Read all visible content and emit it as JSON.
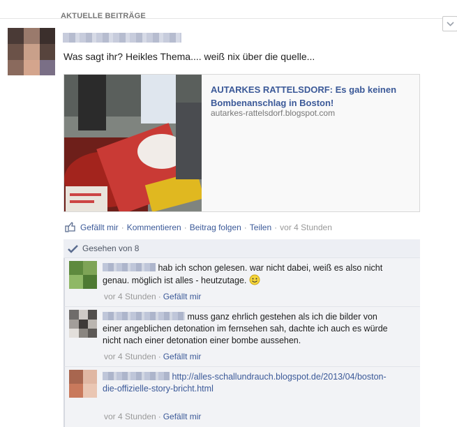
{
  "section": {
    "title": "AKTUELLE BEITRÄGE"
  },
  "post": {
    "text": "Was sagt ihr? Heikles Thema.... weiß nix über die quelle...",
    "link": {
      "title": "AUTARKES RATTELSDORF: Es gab keinen Bombenanschlag in Boston!",
      "domain": "autarkes-rattelsdorf.blogspot.com"
    },
    "actions": {
      "like": "Gefällt mir",
      "comment": "Kommentieren",
      "follow": "Beitrag folgen",
      "share": "Teilen",
      "time": "vor 4 Stunden"
    },
    "seen": "Gesehen von 8"
  },
  "comments": [
    {
      "text": "hab ich schon gelesen. war nicht dabei, weiß es also nicht genau. möglich ist alles - heutzutage.",
      "time": "vor 4 Stunden",
      "like": "Gefällt mir"
    },
    {
      "text": "muss ganz ehrlich gestehen als ich die bilder von einer angeblichen detonation im fernsehen sah, dachte ich auch es würde nicht nach einer detonation einer bombe aussehen.",
      "time": "vor 4 Stunden",
      "like": "Gefällt mir"
    },
    {
      "text": "http://alles-schallundrauch.blogspot.de/2013/04/boston-die-offizielle-story-bricht.html",
      "time": "vor 4 Stunden",
      "like": "Gefällt mir"
    }
  ],
  "icons": {
    "collapse": "chevron-down-icon",
    "like": "like-thumb-icon",
    "seen": "checkmark-icon",
    "smiley": "smiley-icon"
  },
  "colors": {
    "link": "#3b5998",
    "meta": "#999999",
    "comment_bg": "#f2f3f6"
  }
}
